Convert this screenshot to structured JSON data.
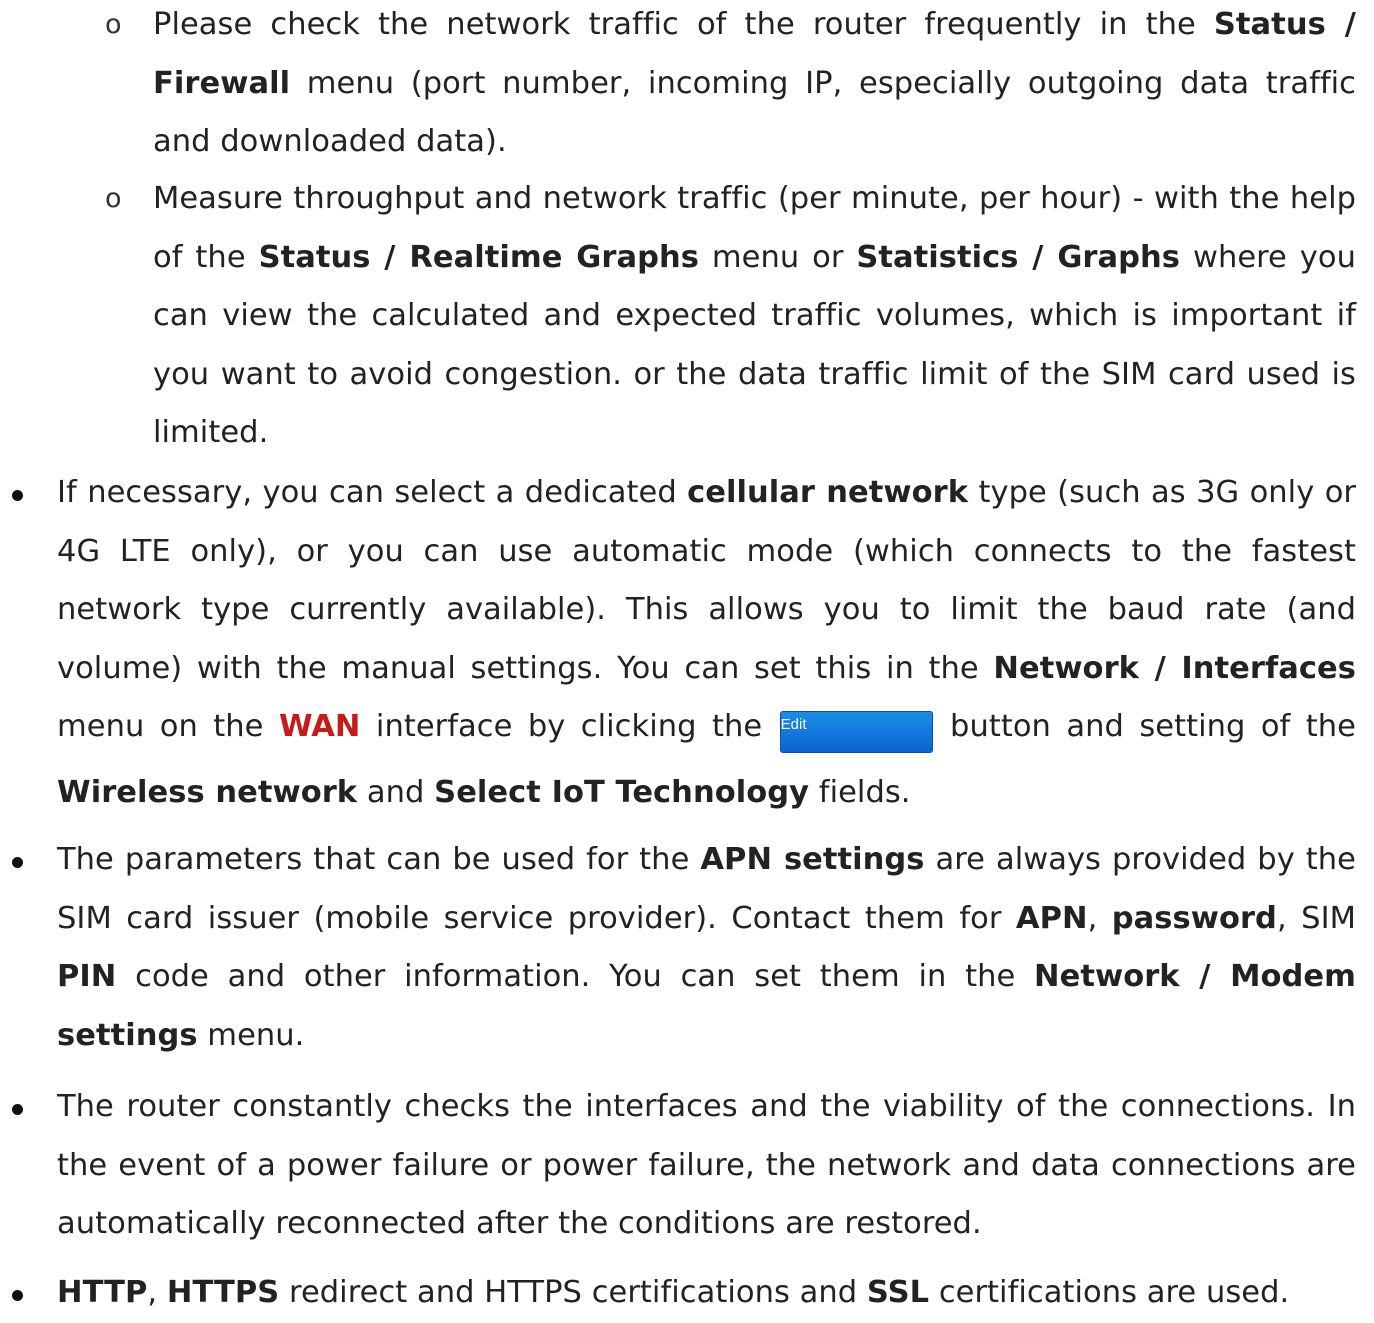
{
  "sub_items": [
    {
      "marker": "o",
      "p1": "Please check the network traffic of the router frequently in the ",
      "b1": "Status / Firewall",
      "p2": " menu (port number, incoming IP, especially outgoing data traffic and downloaded data)."
    },
    {
      "marker": "o",
      "p1": "Measure throughput and network traffic (per minute, per hour) - with the help of the ",
      "b1": "Status / Realtime Graphs",
      "p2": " menu or ",
      "b2": "Statistics / Graphs",
      "p3": " where you can view the calculated and expected traffic volumes, which is important if you want to avoid congestion. or the data traffic limit of the SIM card used is limited."
    }
  ],
  "bullet1": {
    "p1": "If necessary, you can select a dedicated ",
    "b1": "cellular network",
    "p2": " type (such as 3G only or 4G LTE only), or you can use automatic mode (which connects to the fastest network type currently available). This allows you to limit the baud rate (and volume) with the manual settings. You can set this in the ",
    "b2": "Network / Interfaces",
    "p3": " menu on the ",
    "wan": "WAN",
    "p4": " interface by clicking the ",
    "edit_button": "Edit",
    "p5": " button and setting of the ",
    "b3": "Wireless network",
    "p6": " and ",
    "b4": "Select IoT Technology",
    "p7": " fields."
  },
  "bullet2": {
    "p1": "The parameters that can be used for the ",
    "b1": "APN settings",
    "p2": " are always provided by the SIM card issuer (mobile service provider). Contact them for ",
    "b2": "APN",
    "p3": ", ",
    "b3": "password",
    "p4": ", SIM ",
    "b4": "PIN",
    "p5": " code and other information. You can set them in the ",
    "b5": "Network / Modem settings",
    "p6": " menu."
  },
  "bullet3": {
    "p1": "The router constantly checks the interfaces and the viability of the connections. In the event of a power failure or power failure, the network and data connections are automatically reconnected after the conditions are restored."
  },
  "bullet4": {
    "b1": "HTTP",
    "p1": ", ",
    "b2": "HTTPS",
    "p2": " redirect and HTTPS certifications and ",
    "b3": "SSL",
    "p3": " certifications are used."
  },
  "colors": {
    "text": "#222222",
    "accent_red": "#c51b1b",
    "button_blue": "#0b63cf"
  }
}
